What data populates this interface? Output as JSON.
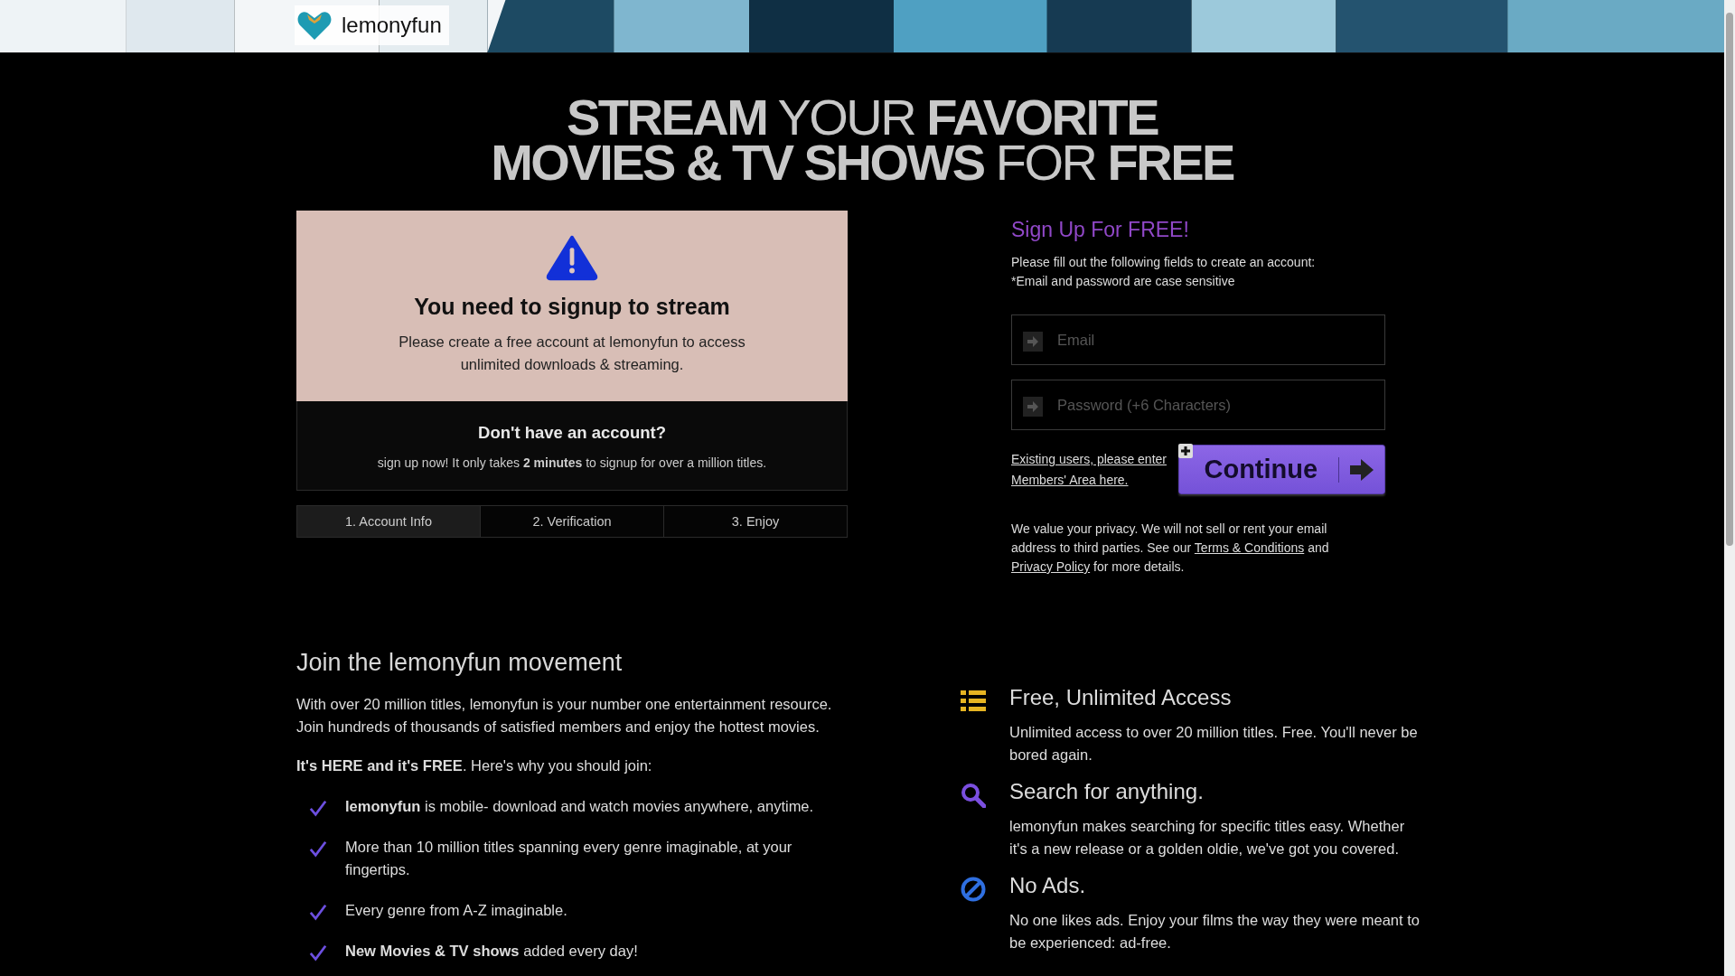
{
  "header": {
    "brand": "lemonyfun"
  },
  "headline": {
    "lines": [
      "**STREAM** YOUR **FAVORITE**",
      "**MOVIES & TV SHOWS** FOR **FREE**"
    ]
  },
  "notice": {
    "title": "You need to signup to stream",
    "text": "Please create a free account at lemonyfun to access unlimited downloads & streaming."
  },
  "account_prompt": {
    "title": "Don't have an account?",
    "text": "sign up now! It only takes **2 minutes** to signup for over a million titles."
  },
  "steps": [
    {
      "label": "1. Account Info",
      "selected": true
    },
    {
      "label": "2. Verification",
      "selected": false
    },
    {
      "label": "3. Enjoy",
      "selected": false
    }
  ],
  "signup": {
    "title": "Sign Up For FREE!",
    "instructions": [
      "Please fill out the following fields to create an account:",
      "*Email and password are case sensitive"
    ],
    "fields": [
      {
        "placeholder": "Email"
      },
      {
        "placeholder": "Password (+6 Characters)"
      }
    ],
    "members_link": "Existing users, please enter Members' Area here.",
    "continue_button": "Continue",
    "privacy": {
      "text_before": "We value your privacy. We will not sell or rent your email address to third parties. See our",
      "terms_link": "Terms & Conditions",
      "middle": "and",
      "policy_link": "Privacy Policy",
      "text_after": "for more details."
    }
  },
  "about": {
    "title": "Join the lemonyfun movement",
    "intro": "With over 20 million titles, lemonyfun is your number one entertainment resource. Join hundreds of thousands of satisfied members and enjoy the hottest movies.",
    "lead": "**It's HERE and it's FREE**. Here's why you should join:",
    "benefits": [
      "**lemonyfun** is mobile- download and watch movies anywhere, anytime.",
      "More than 10 million titles spanning every genre imaginable, at your fingertips.",
      "Every genre from A-Z imaginable.",
      "**New Movies & TV shows** added every day!"
    ]
  },
  "features": [
    {
      "kind": "list",
      "color": "#e6b422",
      "title": "Free, Unlimited Access",
      "text": "Unlimited access to over 20 million titles. Free. You'll never be bored again."
    },
    {
      "kind": "search",
      "color": "#7b4fe0",
      "title": "Search for anything.",
      "text": "lemonyfun makes searching for specific titles easy. Whether it's a new release or a golden oldie, we've got you covered."
    },
    {
      "kind": "ban",
      "color": "#2f6fe0",
      "title": "No Ads.",
      "text": "No one likes ads. Enjoy your films the way they were meant to be experienced: ad-free."
    }
  ]
}
